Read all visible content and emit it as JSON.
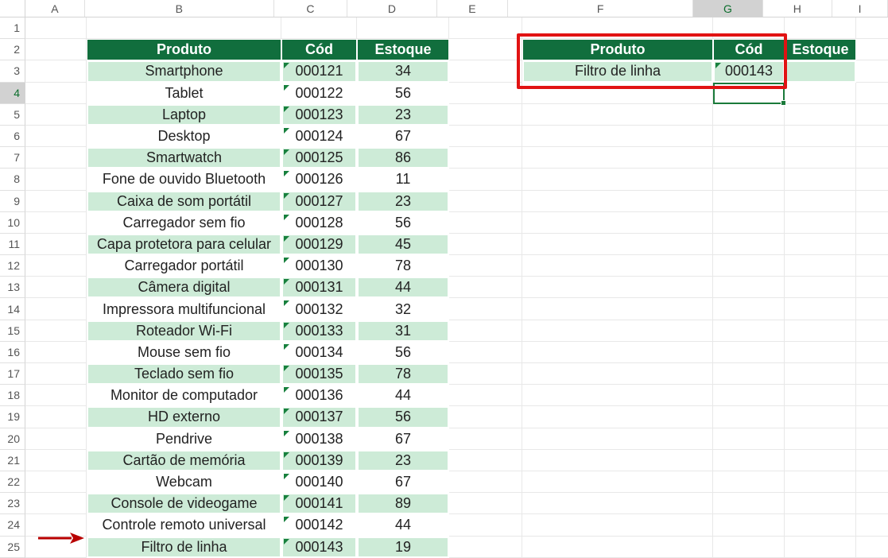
{
  "columns": [
    "A",
    "B",
    "C",
    "D",
    "E",
    "F",
    "G",
    "H",
    "I"
  ],
  "row_count": 25,
  "selected_cell": "G4",
  "table1": {
    "headers": {
      "produto": "Produto",
      "cod": "Cód",
      "estoque": "Estoque"
    },
    "rows": [
      {
        "produto": "Smartphone",
        "cod": "000121",
        "estoque": "34"
      },
      {
        "produto": "Tablet",
        "cod": "000122",
        "estoque": "56"
      },
      {
        "produto": "Laptop",
        "cod": "000123",
        "estoque": "23"
      },
      {
        "produto": "Desktop",
        "cod": "000124",
        "estoque": "67"
      },
      {
        "produto": "Smartwatch",
        "cod": "000125",
        "estoque": "86"
      },
      {
        "produto": "Fone de ouvido Bluetooth",
        "cod": "000126",
        "estoque": "11"
      },
      {
        "produto": "Caixa de som portátil",
        "cod": "000127",
        "estoque": "23"
      },
      {
        "produto": "Carregador sem fio",
        "cod": "000128",
        "estoque": "56"
      },
      {
        "produto": "Capa protetora para celular",
        "cod": "000129",
        "estoque": "45"
      },
      {
        "produto": "Carregador portátil",
        "cod": "000130",
        "estoque": "78"
      },
      {
        "produto": "Câmera digital",
        "cod": "000131",
        "estoque": "44"
      },
      {
        "produto": "Impressora multifuncional",
        "cod": "000132",
        "estoque": "32"
      },
      {
        "produto": "Roteador Wi-Fi",
        "cod": "000133",
        "estoque": "31"
      },
      {
        "produto": "Mouse sem fio",
        "cod": "000134",
        "estoque": "56"
      },
      {
        "produto": "Teclado sem fio",
        "cod": "000135",
        "estoque": "78"
      },
      {
        "produto": "Monitor de computador",
        "cod": "000136",
        "estoque": "44"
      },
      {
        "produto": "HD externo",
        "cod": "000137",
        "estoque": "56"
      },
      {
        "produto": "Pendrive",
        "cod": "000138",
        "estoque": "67"
      },
      {
        "produto": "Cartão de memória",
        "cod": "000139",
        "estoque": "23"
      },
      {
        "produto": "Webcam",
        "cod": "000140",
        "estoque": "67"
      },
      {
        "produto": "Console de videogame",
        "cod": "000141",
        "estoque": "89"
      },
      {
        "produto": "Controle remoto universal",
        "cod": "000142",
        "estoque": "44"
      },
      {
        "produto": "Filtro de linha",
        "cod": "000143",
        "estoque": "19"
      }
    ]
  },
  "table2": {
    "headers": {
      "produto": "Produto",
      "cod": "Cód",
      "estoque": "Estoque"
    },
    "row": {
      "produto": "Filtro de linha",
      "cod": "000143",
      "estoque": ""
    }
  },
  "annotations": {
    "highlight_box": "F2:G3",
    "arrow_points_to_row": 25
  },
  "colors": {
    "header_bg": "#116E3D",
    "row_alt": "#cdebd7",
    "callout": "#e11313",
    "selection": "#1a7a3a"
  }
}
